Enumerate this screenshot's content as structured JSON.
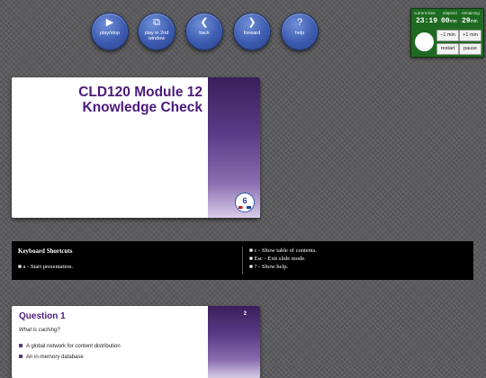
{
  "nav": {
    "play_stop": "play/stop",
    "play_window": "play in 2nd window",
    "back": "back",
    "forward": "forward",
    "help": "help",
    "icons": {
      "play": "play-icon",
      "window": "window-icon",
      "back": "chevron-left-icon",
      "forward": "chevron-right-icon",
      "help": "question-icon"
    }
  },
  "timer": {
    "current_time_label": "current time",
    "elapsed_label": "elapsed",
    "remaining_label": "remaining",
    "current_time": "23:19",
    "elapsed": "00",
    "remaining": "29",
    "unit": "min",
    "minus_label": "−1 min",
    "plus_label": "+1 min",
    "restart_label": "restart",
    "pause_label": "pause"
  },
  "slide1": {
    "title_line1": "CLD120 Module 12",
    "title_line2": "Knowledge Check",
    "logo_text": "6"
  },
  "shortcuts": {
    "heading": "Keyboard Shortcuts",
    "items": [
      "■  a - Start presentation.",
      "■  c - Show table of contents.",
      "■  Esc - Exit slide mode.",
      "■  ? - Show help."
    ]
  },
  "slide2": {
    "number": "2",
    "title": "Question 1",
    "question": "What is caching?",
    "options": [
      "A global network for content distribution",
      "An in-memory database"
    ]
  },
  "colors": {
    "accent_purple": "#4c1a7a",
    "nav_blue": "#3d5cb0",
    "timer_green": "#1f6a22"
  }
}
